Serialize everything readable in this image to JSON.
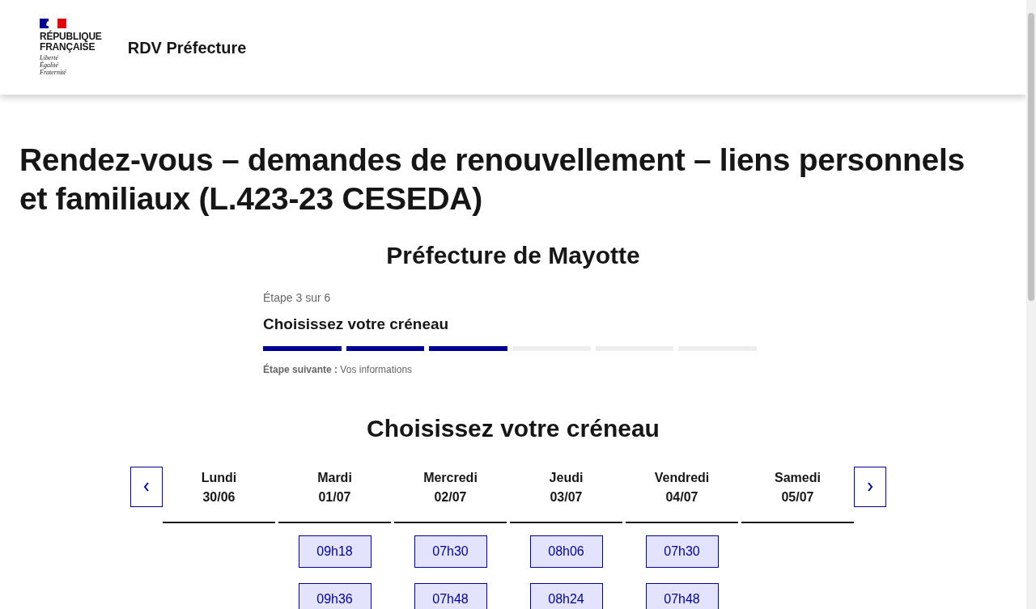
{
  "header": {
    "logo_lines": [
      "RÉPUBLIQUE",
      "FRANÇAISE"
    ],
    "motto": [
      "Liberté",
      "Égalité",
      "Fraternité"
    ],
    "service_title": "RDV Préfecture"
  },
  "page_title": "Rendez-vous – demandes de renouvellement – liens personnels et familiaux (L.423-23 CESEDA)",
  "prefecture": "Préfecture de Mayotte",
  "stepper": {
    "step_label": "Étape 3 sur 6",
    "title": "Choisissez votre créneau",
    "segments": [
      {
        "filled": true
      },
      {
        "filled": true
      },
      {
        "filled": true
      },
      {
        "filled": false
      },
      {
        "filled": false
      },
      {
        "filled": false
      }
    ],
    "next": "**Étape suivante :** Vos informations"
  },
  "slots": {
    "title": "Choisissez votre créneau",
    "days": [
      {
        "day": "Lundi",
        "date": "30/06"
      },
      {
        "day": "Mardi",
        "date": "01/07",
        "times": [
          "09h18",
          "09h36"
        ]
      },
      {
        "day": "Mercredi",
        "date": "02/07",
        "times": [
          "07h30",
          "07h48"
        ]
      },
      {
        "day": "Jeudi",
        "date": "03/07",
        "times": [
          "08h06",
          "08h24"
        ]
      },
      {
        "day": "Vendredi",
        "date": "04/07",
        "times": [
          "07h30",
          "07h48"
        ]
      },
      {
        "day": "Samedi",
        "date": "05/07"
      }
    ]
  }
}
